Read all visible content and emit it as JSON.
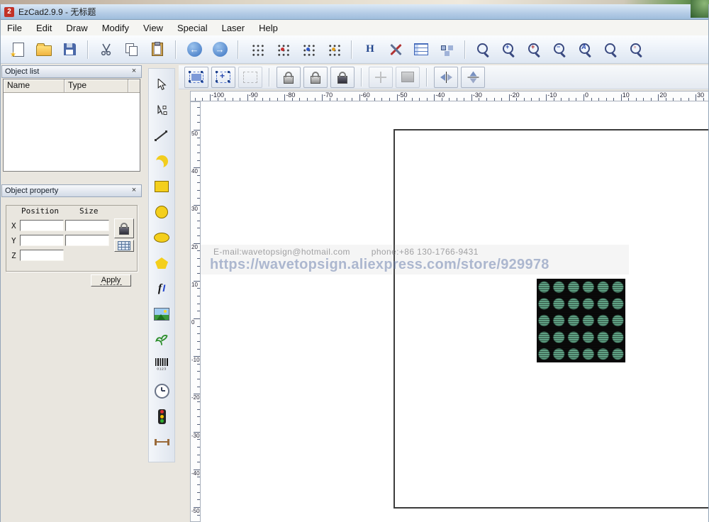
{
  "window": {
    "title": "EzCad2.9.9 - 无标题",
    "logo_text": "2"
  },
  "menu": {
    "items": [
      "File",
      "Edit",
      "Draw",
      "Modify",
      "View",
      "Special",
      "Laser",
      "Help"
    ]
  },
  "toolbar": {
    "icons": [
      "new",
      "open",
      "save",
      "cut",
      "copy",
      "paste",
      "undo",
      "redo",
      "dot-matrix-1",
      "dot-matrix-2",
      "dot-matrix-3",
      "dot-matrix-4",
      "hatch",
      "param-tools",
      "object-list",
      "object-browse",
      "zoom-window",
      "zoom-in",
      "zoom-move",
      "zoom-out",
      "zoom-all",
      "zoom-page",
      "zoom-object"
    ],
    "hatch_label": "H",
    "zoom_all_label": "A",
    "zoom_in_label": "+",
    "zoom_out_label": "−",
    "zoom_move_label": "+"
  },
  "edit_toolbar": {
    "icons": [
      "pick-object",
      "pick-node",
      "marquee",
      "lock-x",
      "lock-y",
      "lock-z",
      "axis-move",
      "fill",
      "mirror-horizontal",
      "mirror-vertical"
    ]
  },
  "draw_toolbar": {
    "icons": [
      "select",
      "node-edit",
      "line",
      "curve",
      "rectangle",
      "circle",
      "ellipse",
      "polygon",
      "text",
      "bitmap",
      "vector-file",
      "barcode",
      "delay",
      "input-port",
      "output-port"
    ],
    "text_label_f": "f",
    "text_label_i": "I",
    "barcode_digits": "0123"
  },
  "object_list_panel": {
    "title": "Object list",
    "close_label": "×",
    "columns": [
      "Name",
      "Type"
    ],
    "rows": []
  },
  "object_property_panel": {
    "title": "Object property",
    "close_label": "×",
    "position_label": "Position",
    "size_label": "Size",
    "axes": [
      {
        "label": "X",
        "position": "",
        "size": ""
      },
      {
        "label": "Y",
        "position": "",
        "size": ""
      },
      {
        "label": "Z",
        "position": ""
      }
    ],
    "apply_label": "Apply"
  },
  "rulers": {
    "horizontal_labels": [
      -100,
      -90,
      -80,
      -70,
      -60,
      -50,
      -40,
      -30,
      -20,
      -10,
      0,
      10,
      20,
      30
    ],
    "vertical_labels": [
      50,
      40,
      30,
      20,
      10,
      0,
      -10,
      -20,
      -30,
      -40,
      -50
    ]
  },
  "canvas": {
    "watermark_line1": "E-mail:wavetopsign@hotmail.com        phone:+86 130-1766-9431",
    "watermark_line2": "https://wavetopsign.aliexpress.com/store/929978"
  },
  "colors": {
    "title_gradient_end": "#9fbddc",
    "accent_yellow": "#f4cf1c",
    "page_border": "#3c3c3c",
    "dot_color": "#5fa083",
    "dot_background": "#0b0b0b"
  }
}
